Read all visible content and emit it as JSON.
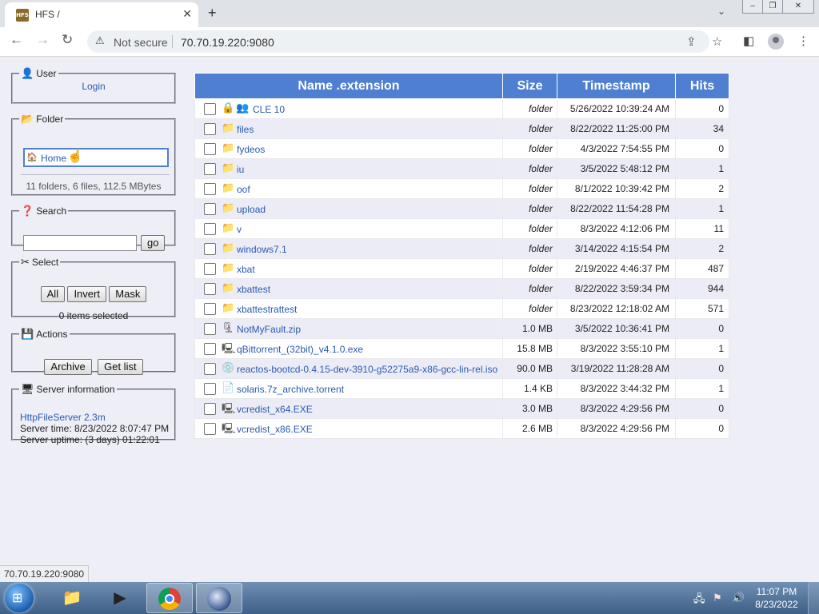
{
  "browser": {
    "tab_title": "HFS /",
    "tab_favicon": "HFS",
    "not_secure": "Not secure",
    "url": "70.70.19.220:9080",
    "status_url": "70.70.19.220:9080"
  },
  "sidebar": {
    "user": {
      "legend": "User",
      "login": "Login"
    },
    "folder": {
      "legend": "Folder",
      "home": "Home",
      "summary": "11 folders, 6 files, 112.5 MBytes"
    },
    "search": {
      "legend": "Search",
      "go": "go",
      "query": ""
    },
    "select": {
      "legend": "Select",
      "all": "All",
      "invert": "Invert",
      "mask": "Mask",
      "selected": "0 items selected"
    },
    "actions": {
      "legend": "Actions",
      "archive": "Archive",
      "get_list": "Get list"
    },
    "server": {
      "legend": "Server information",
      "version": "HttpFileServer 2.3m",
      "time": "Server time: 8/23/2022 8:07:47 PM",
      "uptime": "Server uptime: (3 days) 01:22:01"
    }
  },
  "table": {
    "headers": {
      "name": "Name .extension",
      "size": "Size",
      "timestamp": "Timestamp",
      "hits": "Hits"
    },
    "rows": [
      {
        "name": "CLE 10",
        "size": "folder",
        "timestamp": "5/26/2022 10:39:24 AM",
        "hits": "0",
        "icon": "locked-folder-icon"
      },
      {
        "name": "files",
        "size": "folder",
        "timestamp": "8/22/2022 11:25:00 PM",
        "hits": "34",
        "icon": "folder-icon"
      },
      {
        "name": "fydeos",
        "size": "folder",
        "timestamp": "4/3/2022 7:54:55 PM",
        "hits": "0",
        "icon": "folder-icon"
      },
      {
        "name": "iu",
        "size": "folder",
        "timestamp": "3/5/2022 5:48:12 PM",
        "hits": "1",
        "icon": "folder-icon"
      },
      {
        "name": "oof",
        "size": "folder",
        "timestamp": "8/1/2022 10:39:42 PM",
        "hits": "2",
        "icon": "folder-icon"
      },
      {
        "name": "upload",
        "size": "folder",
        "timestamp": "8/22/2022 11:54:28 PM",
        "hits": "1",
        "icon": "folder-icon"
      },
      {
        "name": "v",
        "size": "folder",
        "timestamp": "8/3/2022 4:12:06 PM",
        "hits": "11",
        "icon": "folder-icon"
      },
      {
        "name": "windows7.1",
        "size": "folder",
        "timestamp": "3/14/2022 4:15:54 PM",
        "hits": "2",
        "icon": "folder-icon"
      },
      {
        "name": "xbat",
        "size": "folder",
        "timestamp": "2/19/2022 4:46:37 PM",
        "hits": "487",
        "icon": "folder-icon"
      },
      {
        "name": "xbattest",
        "size": "folder",
        "timestamp": "8/22/2022 3:59:34 PM",
        "hits": "944",
        "icon": "folder-icon"
      },
      {
        "name": "xbattestrattest",
        "size": "folder",
        "timestamp": "8/23/2022 12:18:02 AM",
        "hits": "571",
        "icon": "folder-icon"
      },
      {
        "name": "NotMyFault.zip",
        "size": "1.0 MB",
        "timestamp": "3/5/2022 10:36:41 PM",
        "hits": "0",
        "icon": "zip-file-icon"
      },
      {
        "name": "qBittorrent_(32bit)_v4.1.0.exe",
        "size": "15.8 MB",
        "timestamp": "8/3/2022 3:55:10 PM",
        "hits": "1",
        "icon": "exe-file-icon"
      },
      {
        "name": "reactos-bootcd-0.4.15-dev-3910-g52275a9-x86-gcc-lin-rel.iso",
        "size": "90.0 MB",
        "timestamp": "3/19/2022 11:28:28 AM",
        "hits": "0",
        "icon": "iso-file-icon"
      },
      {
        "name": "solaris.7z_archive.torrent",
        "size": "1.4 KB",
        "timestamp": "8/3/2022 3:44:32 PM",
        "hits": "1",
        "icon": "file-icon"
      },
      {
        "name": "vcredist_x64.EXE",
        "size": "3.0 MB",
        "timestamp": "8/3/2022 4:29:56 PM",
        "hits": "0",
        "icon": "exe-file-icon"
      },
      {
        "name": "vcredist_x86.EXE",
        "size": "2.6 MB",
        "timestamp": "8/3/2022 4:29:56 PM",
        "hits": "0",
        "icon": "exe-file-icon"
      }
    ]
  },
  "taskbar": {
    "time": "11:07 PM",
    "date": "8/23/2022"
  },
  "colors": {
    "header_bg": "#4f7fd0",
    "link": "#2a5ab0",
    "page_bg": "#eeeef6"
  }
}
